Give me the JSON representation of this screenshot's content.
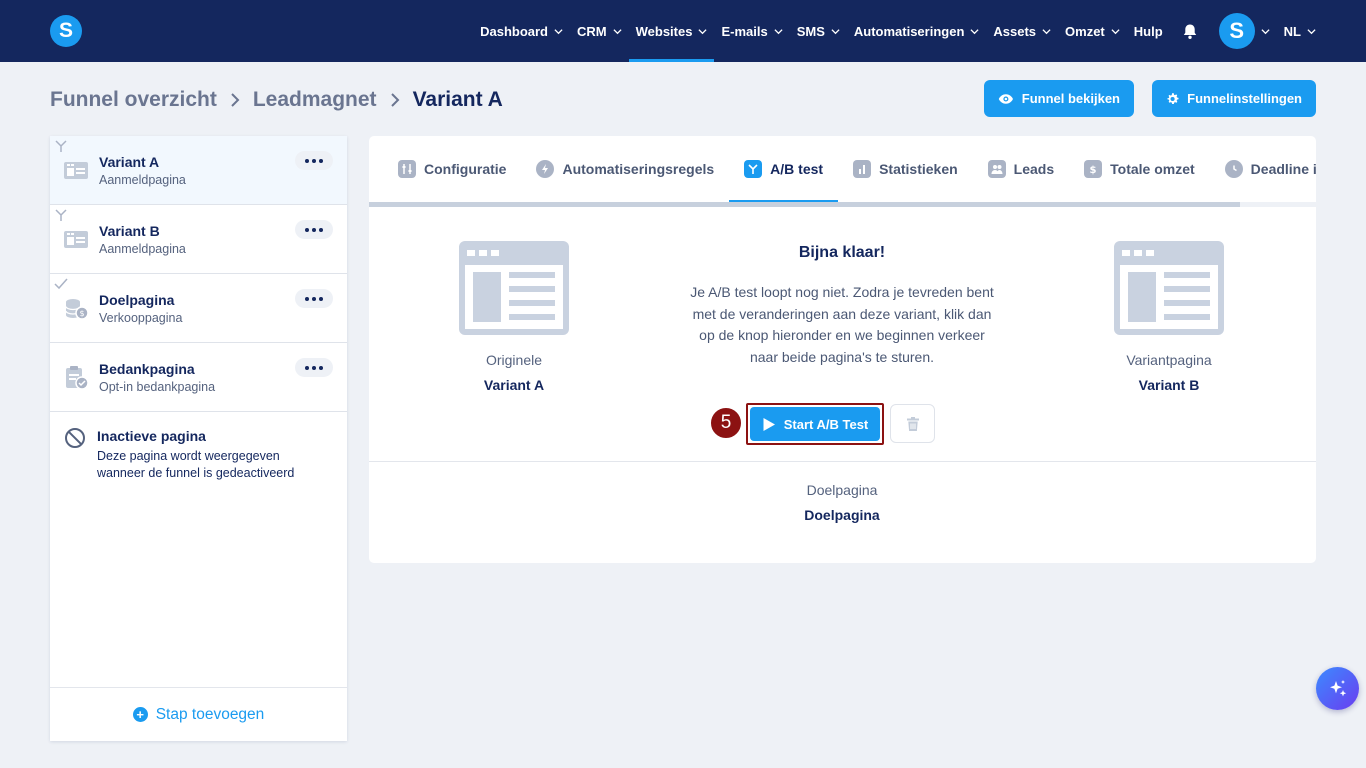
{
  "colors": {
    "navbar": "#14275e",
    "accent": "#1a9bf0",
    "page_bg": "#eef1f6",
    "step_badge": "#8c1212"
  },
  "navbar": {
    "logo_letter": "S",
    "items": [
      {
        "label": "Dashboard",
        "active": false
      },
      {
        "label": "CRM",
        "active": false
      },
      {
        "label": "Websites",
        "active": true
      },
      {
        "label": "E-mails",
        "active": false
      },
      {
        "label": "SMS",
        "active": false
      },
      {
        "label": "Automatiseringen",
        "active": false
      },
      {
        "label": "Assets",
        "active": false
      },
      {
        "label": "Omzet",
        "active": false
      },
      {
        "label": "Hulp",
        "active": false
      }
    ],
    "notification_icon": "bell-icon",
    "avatar_letter": "S",
    "language": "NL"
  },
  "breadcrumb": {
    "items": [
      "Funnel overzicht",
      "Leadmagnet",
      "Variant A"
    ]
  },
  "header_actions": {
    "view_funnel": "Funnel bekijken",
    "funnel_settings": "Funnelinstellingen"
  },
  "sidebar": {
    "steps": [
      {
        "title": "Variant A",
        "subtitle": "Aanmeldpagina",
        "icon": "page-layout-icon",
        "marker": "split-icon",
        "selected": true
      },
      {
        "title": "Variant B",
        "subtitle": "Aanmeldpagina",
        "icon": "page-layout-icon",
        "marker": "split-icon",
        "selected": false
      },
      {
        "title": "Doelpagina",
        "subtitle": "Verkooppagina",
        "icon": "coins-icon",
        "marker": "check-icon",
        "selected": false
      },
      {
        "title": "Bedankpagina",
        "subtitle": "Opt-in bedankpagina",
        "icon": "clipboard-check-icon",
        "marker": "",
        "selected": false
      }
    ],
    "inactive": {
      "title": "Inactieve pagina",
      "description": "Deze pagina wordt weergegeven wanneer de funnel is gedeactiveerd"
    },
    "add_step": "Stap toevoegen"
  },
  "tabs": [
    {
      "label": "Configuratie",
      "icon": "sliders-icon",
      "active": false
    },
    {
      "label": "Automatiseringsregels",
      "icon": "bolt-icon",
      "active": false
    },
    {
      "label": "A/B test",
      "icon": "split-icon",
      "active": true
    },
    {
      "label": "Statistieken",
      "icon": "bar-chart-icon",
      "active": false
    },
    {
      "label": "Leads",
      "icon": "users-icon",
      "active": false
    },
    {
      "label": "Totale omzet",
      "icon": "dollar-icon",
      "active": false
    },
    {
      "label": "Deadline in",
      "icon": "clock-icon",
      "active": false
    }
  ],
  "ab_test": {
    "title": "Bijna klaar!",
    "description": "Je A/B test loopt nog niet. Zodra je tevreden bent met de veranderingen aan deze variant, klik dan op de knop hieronder en we beginnen verkeer naar beide pagina's te sturen.",
    "original_label": "Originele",
    "original_value": "Variant A",
    "variant_label": "Variantpagina",
    "variant_value": "Variant B",
    "start_button": "Start A/B Test",
    "step_number": "5",
    "goal_label": "Doelpagina",
    "goal_value": "Doelpagina"
  }
}
